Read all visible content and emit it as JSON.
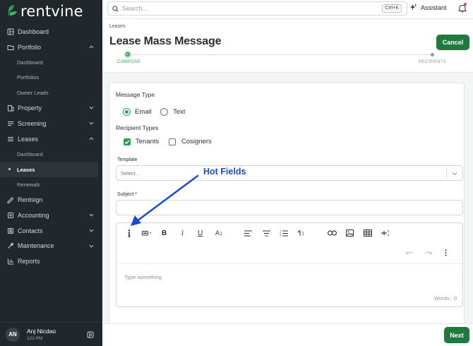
{
  "brand": {
    "name": "rentvine",
    "accent": "#2f9e55",
    "button_green": "#1f7a3f"
  },
  "sidebar": {
    "items": [
      {
        "id": "dashboard",
        "label": "Dashboard",
        "icon": "dashboard-icon"
      },
      {
        "id": "portfolio",
        "label": "Portfolio",
        "icon": "folder-icon",
        "expanded": true,
        "children": [
          "Dashboard",
          "Portfolios",
          "Owner Leads"
        ]
      },
      {
        "id": "property",
        "label": "Property",
        "icon": "building-icon"
      },
      {
        "id": "screening",
        "label": "Screening",
        "icon": "screening-icon"
      },
      {
        "id": "leases",
        "label": "Leases",
        "icon": "lease-icon",
        "expanded": true,
        "children": [
          "Dashboard",
          "Leases",
          "Renewals"
        ],
        "active_child": "Leases"
      },
      {
        "id": "rentsign",
        "label": "Rentsign",
        "icon": "signature-icon"
      },
      {
        "id": "accounting",
        "label": "Accounting",
        "icon": "accounting-icon"
      },
      {
        "id": "contacts",
        "label": "Contacts",
        "icon": "contacts-icon"
      },
      {
        "id": "maintenance",
        "label": "Maintenance",
        "icon": "wrench-icon"
      },
      {
        "id": "reports",
        "label": "Reports",
        "icon": "chart-icon"
      }
    ],
    "user": {
      "initials": "AN",
      "name": "Anj Nicdao",
      "subtitle": "123 PM"
    }
  },
  "topbar": {
    "search_placeholder": "Search...",
    "search_shortcut": "Ctrl+K",
    "assistant_label": "Assistant"
  },
  "header": {
    "breadcrumb": "Leases",
    "title": "Lease Mass Message",
    "cancel_label": "Cancel",
    "steps": [
      "COMPOSE",
      "RECIPIENTS"
    ]
  },
  "form": {
    "message_type_label": "Message Type",
    "message_types": [
      "Email",
      "Text"
    ],
    "message_type_selected": "Email",
    "recipient_types_label": "Recipient Types",
    "recipient_types": [
      {
        "label": "Tenants",
        "checked": true
      },
      {
        "label": "Cosigners",
        "checked": false
      }
    ],
    "template_label": "Template",
    "template_placeholder": "Select...",
    "subject_label": "Subject *",
    "subject_value": "",
    "editor_placeholder": "Type something",
    "word_count": "Words : 0"
  },
  "footer": {
    "next_label": "Next"
  },
  "annotation": {
    "text": "Hot Fields",
    "color": "#1a49d6"
  }
}
